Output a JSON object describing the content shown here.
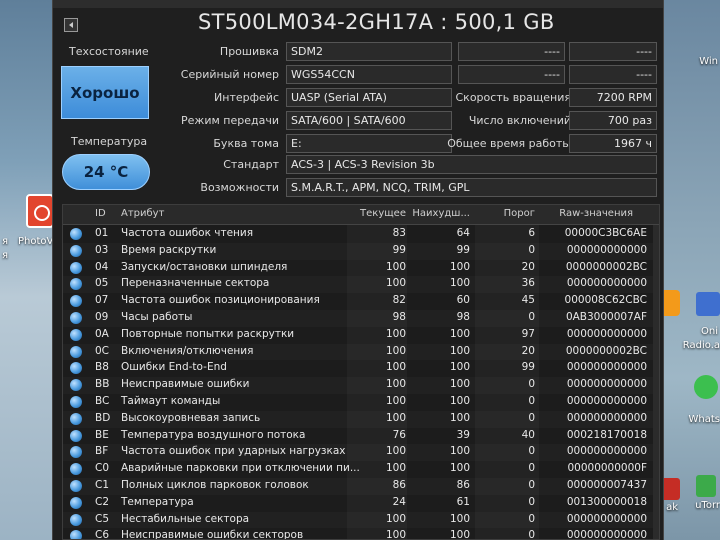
{
  "header": {
    "disk_title": "ST500LM034-2GH17A : 500,1 GB"
  },
  "status": {
    "tech_label": "Техсостояние",
    "health": "Хорошо",
    "temp_label": "Температура",
    "temperature": "24 °C"
  },
  "info": {
    "firmware_label": "Прошивка",
    "firmware": "SDM2",
    "serial_label": "Серийный номер",
    "serial": "WGS54CCN",
    "interface_label": "Интерфейс",
    "interface": "UASP (Serial ATA)",
    "transfer_label": "Режим передачи",
    "transfer": "SATA/600 | SATA/600",
    "drive_letter_label": "Буква тома",
    "drive_letter": "E:",
    "standard_label": "Стандарт",
    "standard": "ACS-3 | ACS-3 Revision 3b",
    "features_label": "Возможности",
    "features": "S.M.A.R.T., APM, NCQ, TRIM, GPL",
    "right_blank_1": "----",
    "right_blank_2": "----",
    "rotation_label": "Скорость вращения",
    "rotation": "7200 RPM",
    "power_count_label": "Число включений",
    "power_count": "700 раз",
    "power_hours_label": "Общее время работы",
    "power_hours": "1967 ч"
  },
  "smart": {
    "columns": {
      "id": "ID",
      "attr": "Атрибут",
      "current": "Текущее",
      "worst": "Наихудш...",
      "threshold": "Порог",
      "raw": "Raw-значения"
    },
    "rows": [
      {
        "id": "01",
        "name": "Частота ошибок чтения",
        "cur": "83",
        "worst": "64",
        "thr": "6",
        "raw": "00000C3BC6AE"
      },
      {
        "id": "03",
        "name": "Время раскрутки",
        "cur": "99",
        "worst": "99",
        "thr": "0",
        "raw": "000000000000"
      },
      {
        "id": "04",
        "name": "Запуски/остановки шпинделя",
        "cur": "100",
        "worst": "100",
        "thr": "20",
        "raw": "0000000002BC"
      },
      {
        "id": "05",
        "name": "Переназначенные сектора",
        "cur": "100",
        "worst": "100",
        "thr": "36",
        "raw": "000000000000"
      },
      {
        "id": "07",
        "name": "Частота ошибок позиционирования",
        "cur": "82",
        "worst": "60",
        "thr": "45",
        "raw": "000008C62CBC"
      },
      {
        "id": "09",
        "name": "Часы работы",
        "cur": "98",
        "worst": "98",
        "thr": "0",
        "raw": "0AB3000007AF"
      },
      {
        "id": "0A",
        "name": "Повторные попытки раскрутки",
        "cur": "100",
        "worst": "100",
        "thr": "97",
        "raw": "000000000000"
      },
      {
        "id": "0C",
        "name": "Включения/отключения",
        "cur": "100",
        "worst": "100",
        "thr": "20",
        "raw": "0000000002BC"
      },
      {
        "id": "B8",
        "name": "Ошибки End-to-End",
        "cur": "100",
        "worst": "100",
        "thr": "99",
        "raw": "000000000000"
      },
      {
        "id": "BB",
        "name": "Неисправимые ошибки",
        "cur": "100",
        "worst": "100",
        "thr": "0",
        "raw": "000000000000"
      },
      {
        "id": "BC",
        "name": "Таймаут команды",
        "cur": "100",
        "worst": "100",
        "thr": "0",
        "raw": "000000000000"
      },
      {
        "id": "BD",
        "name": "Высокоуровневая запись",
        "cur": "100",
        "worst": "100",
        "thr": "0",
        "raw": "000000000000"
      },
      {
        "id": "BE",
        "name": "Температура воздушного потока",
        "cur": "76",
        "worst": "39",
        "thr": "40",
        "raw": "000218170018"
      },
      {
        "id": "BF",
        "name": "Частота ошибок при ударных нагрузках",
        "cur": "100",
        "worst": "100",
        "thr": "0",
        "raw": "000000000000"
      },
      {
        "id": "C0",
        "name": "Аварийные парковки при отключении пи...",
        "cur": "100",
        "worst": "100",
        "thr": "0",
        "raw": "00000000000F"
      },
      {
        "id": "C1",
        "name": "Полных циклов парковок головок",
        "cur": "86",
        "worst": "86",
        "thr": "0",
        "raw": "000000007437"
      },
      {
        "id": "C2",
        "name": "Температура",
        "cur": "24",
        "worst": "61",
        "thr": "0",
        "raw": "001300000018"
      },
      {
        "id": "C5",
        "name": "Нестабильные сектора",
        "cur": "100",
        "worst": "100",
        "thr": "0",
        "raw": "000000000000"
      },
      {
        "id": "C6",
        "name": "Неисправимые ошибки секторов",
        "cur": "100",
        "worst": "100",
        "thr": "0",
        "raw": "000000000000"
      }
    ]
  },
  "desktop": {
    "left_labels": [
      "я",
      "PhotoV",
      "я"
    ],
    "right_labels": [
      "Win",
      "Oni",
      "Radio.a",
      "Whats",
      "uTorr",
      "ak"
    ],
    "accent": "#3d8cd9"
  }
}
